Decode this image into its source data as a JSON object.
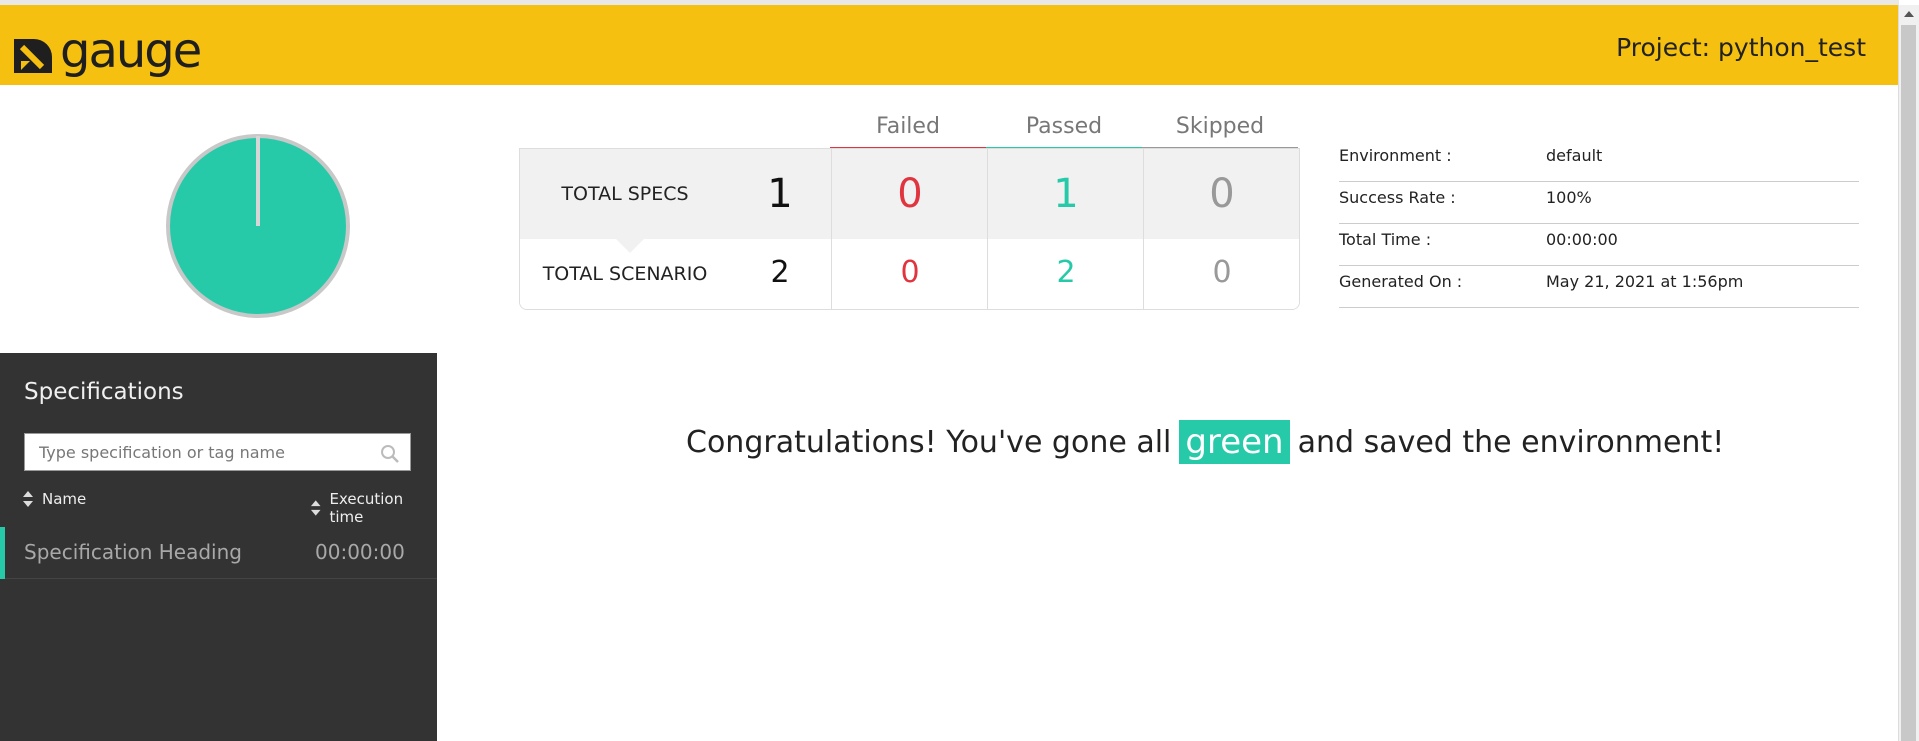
{
  "header": {
    "logo_text": "gauge",
    "project_label": "Project: python_test",
    "bg_color": "#f5c010"
  },
  "summary_chart": {
    "type": "pie",
    "passed": 1,
    "failed": 0,
    "skipped": 0,
    "passed_color": "#27caa8"
  },
  "stats": {
    "columns": [
      {
        "label": "Failed",
        "color": "#e0353f"
      },
      {
        "label": "Passed",
        "color": "#27caa8"
      },
      {
        "label": "Skipped",
        "color": "#999999"
      }
    ],
    "rows": [
      {
        "label": "TOTAL SPECS",
        "total": "1",
        "failed": "0",
        "passed": "1",
        "skipped": "0"
      },
      {
        "label": "TOTAL SCENARIO",
        "total": "2",
        "failed": "0",
        "passed": "2",
        "skipped": "0"
      }
    ]
  },
  "environment": {
    "rows": [
      {
        "key": "Environment :",
        "value": "default"
      },
      {
        "key": "Success Rate :",
        "value": "100%"
      },
      {
        "key": "Total Time :",
        "value": "00:00:00"
      },
      {
        "key": "Generated On :",
        "value": "May 21, 2021 at 1:56pm"
      }
    ]
  },
  "sidebar": {
    "title": "Specifications",
    "search_placeholder": "Type specification or tag name",
    "sort_name": "Name",
    "sort_time": "Execution time",
    "specs": [
      {
        "name": "Specification Heading",
        "time": "00:00:00"
      }
    ]
  },
  "message": {
    "before": "Congratulations! You've gone all",
    "highlight": "green",
    "after": "and saved the environment!"
  }
}
